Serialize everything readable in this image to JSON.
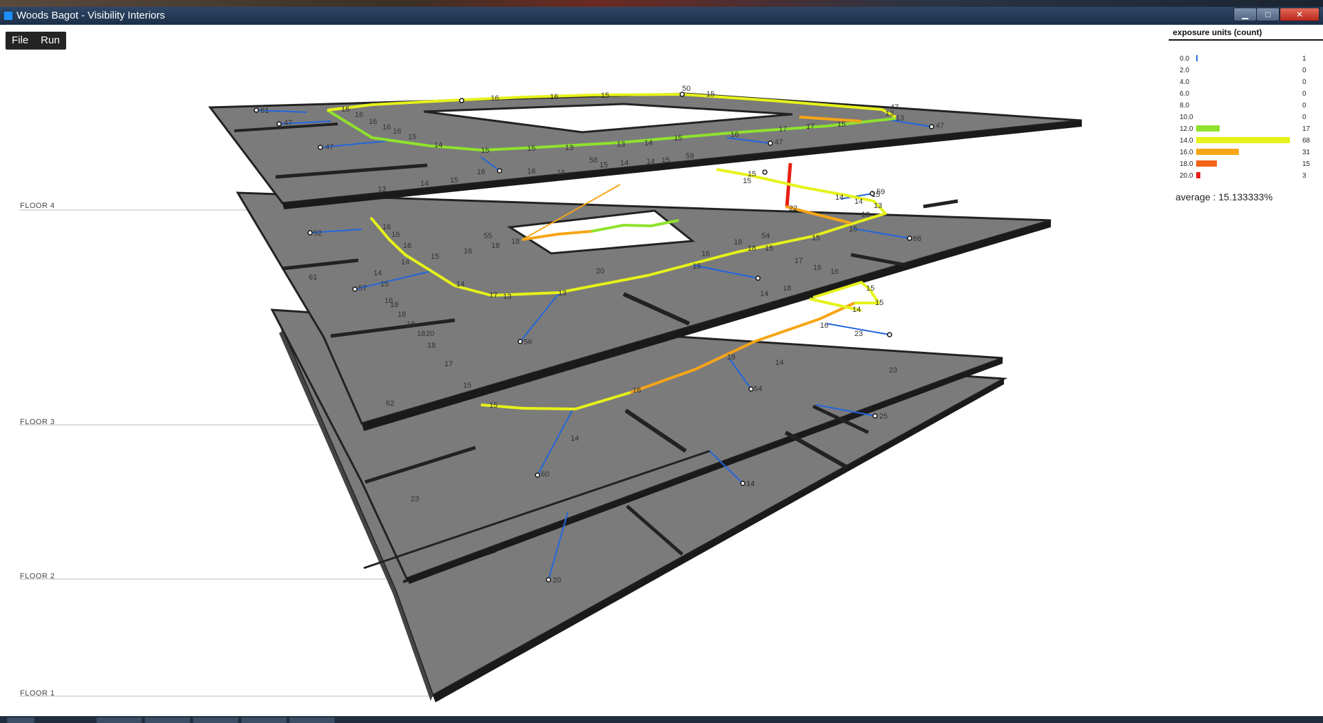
{
  "window": {
    "title": "Woods Bagot - Visibility Interiors",
    "min_glyph": "▁",
    "max_glyph": "□",
    "close_glyph": "✕"
  },
  "menu": {
    "file": "File",
    "run": "Run"
  },
  "floors": [
    "FLOOR 4",
    "FLOOR 3",
    "FLOOR 2",
    "FLOOR 1"
  ],
  "legend": {
    "title": "exposure units (count)",
    "bins": [
      {
        "bin": "0.0",
        "count": 1,
        "color": "#1f6fd6"
      },
      {
        "bin": "2.0",
        "count": 0,
        "color": "#2a8fe0"
      },
      {
        "bin": "4.0",
        "count": 0,
        "color": "#3aa8c8"
      },
      {
        "bin": "6.0",
        "count": 0,
        "color": "#4cc08a"
      },
      {
        "bin": "8.0",
        "count": 0,
        "color": "#6bd050"
      },
      {
        "bin": "10.0",
        "count": 0,
        "color": "#86dd30"
      },
      {
        "bin": "12.0",
        "count": 17,
        "color": "#8fe22c"
      },
      {
        "bin": "14.0",
        "count": 68,
        "color": "#e6f21a"
      },
      {
        "bin": "16.0",
        "count": 31,
        "color": "#f7a516"
      },
      {
        "bin": "18.0",
        "count": 15,
        "color": "#f26316"
      },
      {
        "bin": "20.0",
        "count": 3,
        "color": "#e81e12"
      }
    ],
    "average": "average : 15.133333%"
  },
  "labels": {
    "floor4": [
      "61",
      "47",
      "47",
      "47",
      "16",
      "16",
      "16",
      "16",
      "16",
      "15",
      "15",
      "15",
      "14",
      "13",
      "13",
      "14",
      "15",
      "16",
      "17",
      "17",
      "15",
      "16",
      "16",
      "15",
      "15",
      "13",
      "47",
      "50",
      "16",
      "16",
      "13",
      "14",
      "15",
      "16",
      "58",
      "15",
      "14",
      "14",
      "15",
      "59",
      "47",
      "13",
      "13"
    ],
    "floor3": [
      "52",
      "16",
      "16",
      "16",
      "14",
      "15",
      "16",
      "55",
      "18",
      "18",
      "61",
      "14",
      "15",
      "57",
      "16",
      "18",
      "18",
      "18",
      "20",
      "18",
      "18",
      "17",
      "15",
      "62",
      "20",
      "14",
      "13",
      "17",
      "13",
      "15",
      "16",
      "18",
      "18",
      "54",
      "15",
      "15",
      "17",
      "16",
      "16",
      "18",
      "14",
      "13",
      "13",
      "56",
      "15",
      "15",
      "22",
      "66",
      "14",
      "14",
      "59",
      "15",
      "15"
    ],
    "floor2": [
      "15",
      "15",
      "14",
      "60",
      "23",
      "15",
      "16",
      "18",
      "16",
      "23",
      "54",
      "25",
      "14",
      "14",
      "14"
    ],
    "floor1": [
      "20",
      "14",
      "23"
    ]
  }
}
